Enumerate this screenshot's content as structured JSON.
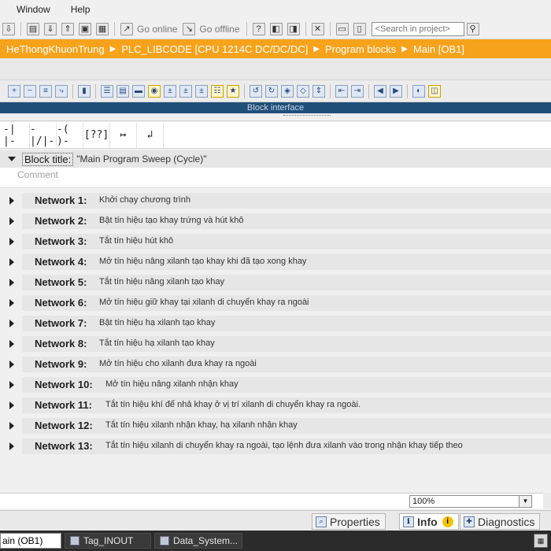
{
  "menu": {
    "items": [
      "Window",
      "Help"
    ]
  },
  "toolbar": {
    "go_online": "Go online",
    "go_offline": "Go offline",
    "search_placeholder": "<Search in project>"
  },
  "breadcrumb": [
    "HeThongKhuonTrung",
    "PLC_LIBCODE [CPU 1214C DC/DC/DC]",
    "Program blocks",
    "Main [OB1]"
  ],
  "block_interface": {
    "label": "Block interface"
  },
  "lad_elements": [
    "-| |-",
    "-|/|-",
    "-( )-",
    "[??]",
    "↦",
    "↲"
  ],
  "block": {
    "title_label": "Block title:",
    "title_value": "\"Main Program Sweep (Cycle)\"",
    "comment_placeholder": "Comment"
  },
  "networks": [
    {
      "label": "Network 1:",
      "comment": "Khởi chạy chương trình"
    },
    {
      "label": "Network 2:",
      "comment": "Bật tín hiệu tạo khay trứng và hút khô"
    },
    {
      "label": "Network 3:",
      "comment": "Tắt tín hiệu hút khô"
    },
    {
      "label": "Network 4:",
      "comment": "Mở tín hiệu nâng xilanh tạo khay khi đã tạo xong khay"
    },
    {
      "label": "Network 5:",
      "comment": "Tắt tín hiệu nâng xilanh tạo khay"
    },
    {
      "label": "Network 6:",
      "comment": "Mở tín hiệu giữ khay tại xilanh di chuyển khay ra ngoài"
    },
    {
      "label": "Network 7:",
      "comment": "Bật tín hiệu hạ xilanh tạo khay"
    },
    {
      "label": "Network 8:",
      "comment": "Tắt tín hiệu hạ xilanh tạo khay"
    },
    {
      "label": "Network 9:",
      "comment": "Mở tín hiệu cho xilanh đưa khay ra ngoài"
    },
    {
      "label": "Network 10:",
      "comment": "Mở tín hiệu nâng xilanh nhận khay"
    },
    {
      "label": "Network 11:",
      "comment": "Tắt tín hiệu khí để nhả khay ở vị trí xilanh di chuyển khay ra ngoài."
    },
    {
      "label": "Network 12:",
      "comment": "Tắt tín hiệu xilanh nhận khay, hạ xilanh nhận khay"
    },
    {
      "label": "Network 13:",
      "comment": "Tắt tín hiệu xilanh di chuyển khay ra ngoài, tạo lệnh đưa xilanh vào trong nhận khay tiếp theo"
    }
  ],
  "zoom": {
    "value": "100%"
  },
  "inspector_tabs": {
    "properties": "Properties",
    "info": "Info",
    "info_badge": "i",
    "diagnostics": "Diagnostics"
  },
  "taskbar": {
    "items": [
      "ain (OB1)",
      "Tag_INOUT",
      "Data_System..."
    ]
  },
  "colors": {
    "breadcrumb_bg": "#f7a21b",
    "block_interface_bg": "#1f4e79",
    "taskbar_bg": "#2b2b2b"
  }
}
